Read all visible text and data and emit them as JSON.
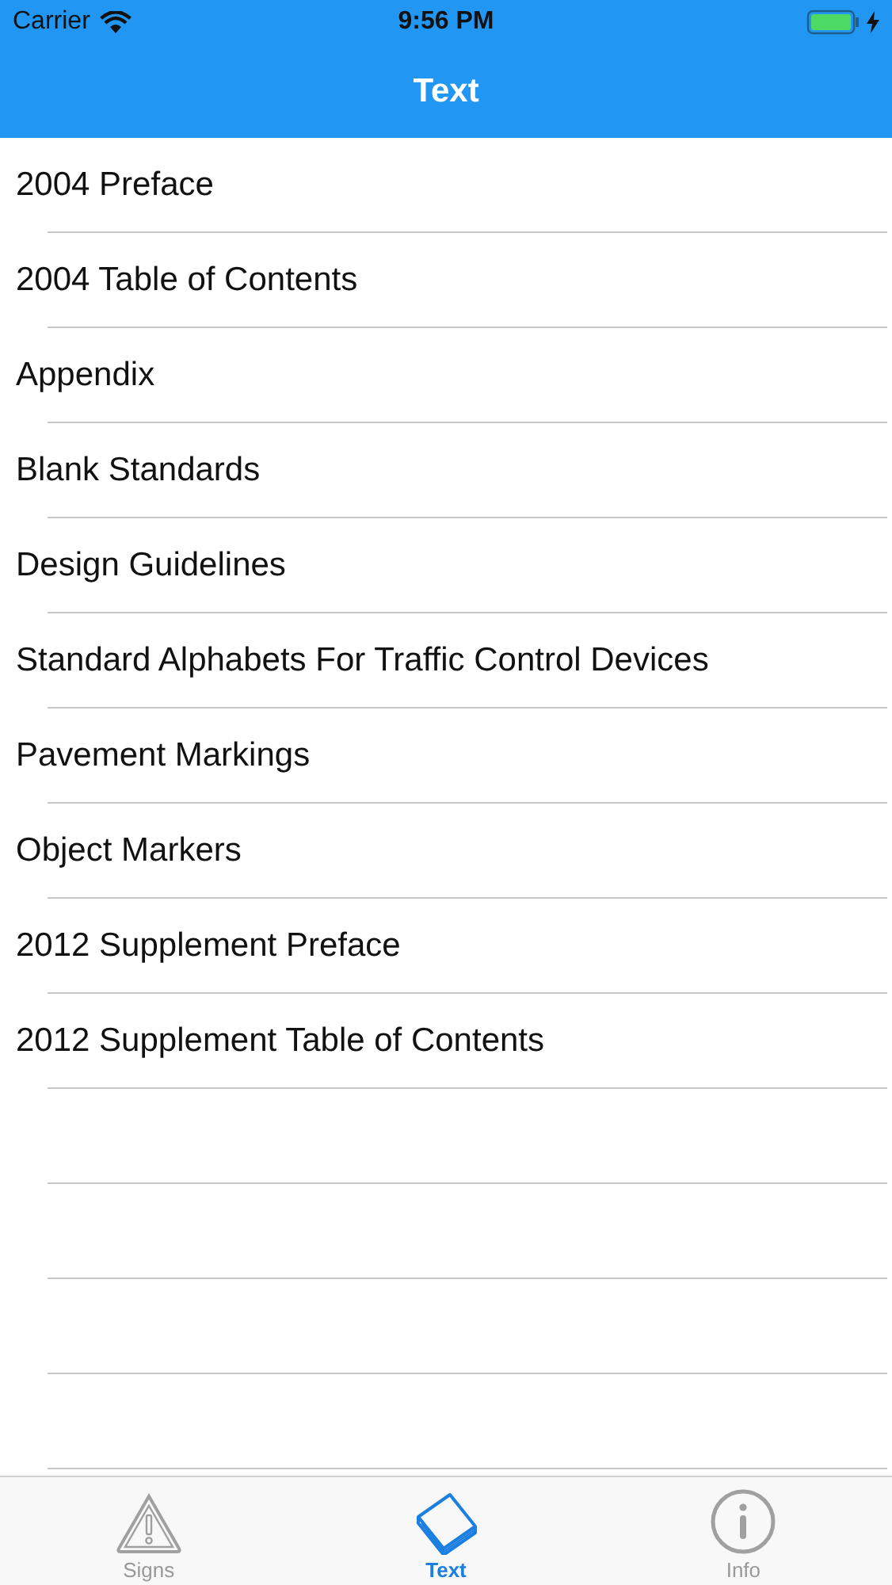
{
  "status_bar": {
    "carrier": "Carrier",
    "time": "9:56 PM"
  },
  "nav_bar": {
    "title": "Text"
  },
  "list": {
    "items": [
      "2004 Preface",
      "2004 Table of Contents",
      "Appendix",
      "Blank Standards",
      "Design Guidelines",
      "Standard Alphabets For Traffic Control Devices",
      "Pavement Markings",
      "Object Markers",
      "2012 Supplement Preface",
      "2012 Supplement Table of Contents"
    ]
  },
  "tab_bar": {
    "tabs": [
      {
        "label": "Signs",
        "selected": false
      },
      {
        "label": "Text",
        "selected": true
      },
      {
        "label": "Info",
        "selected": false
      }
    ]
  }
}
